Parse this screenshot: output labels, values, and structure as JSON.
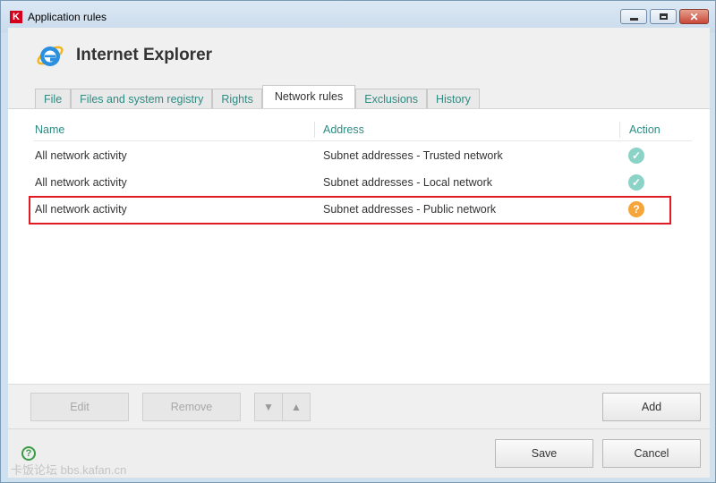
{
  "window": {
    "title": "Application rules"
  },
  "header": {
    "app_name": "Internet Explorer"
  },
  "tabs": [
    {
      "label": "File",
      "active": false
    },
    {
      "label": "Files and system registry",
      "active": false
    },
    {
      "label": "Rights",
      "active": false
    },
    {
      "label": "Network rules",
      "active": true
    },
    {
      "label": "Exclusions",
      "active": false
    },
    {
      "label": "History",
      "active": false
    }
  ],
  "table": {
    "columns": {
      "name": "Name",
      "address": "Address",
      "action": "Action"
    },
    "rows": [
      {
        "name": "All network activity",
        "address": "Subnet addresses - Trusted network",
        "action": "allow",
        "action_icon": "check-icon",
        "highlighted": false
      },
      {
        "name": "All network activity",
        "address": "Subnet addresses - Local network",
        "action": "allow",
        "action_icon": "check-icon",
        "highlighted": false
      },
      {
        "name": "All network activity",
        "address": "Subnet addresses - Public network",
        "action": "prompt",
        "action_icon": "question-icon",
        "highlighted": true
      }
    ]
  },
  "toolbar": {
    "edit_label": "Edit",
    "remove_label": "Remove",
    "add_label": "Add"
  },
  "footer": {
    "save_label": "Save",
    "cancel_label": "Cancel",
    "watermark": "卡饭论坛 bbs.kafan.cn"
  },
  "colors": {
    "accent": "#2e8b82",
    "allow": "#8cd3c7",
    "prompt": "#f6a53a",
    "highlight_border": "#e01b24"
  }
}
